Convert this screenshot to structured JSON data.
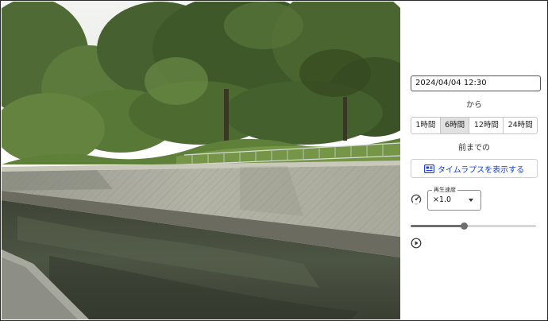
{
  "camera": {
    "scene": "river-channel-camera-image"
  },
  "controls": {
    "datetime_value": "2024/04/04 12:30",
    "from_label": "から",
    "ranges": [
      {
        "label": "1時間",
        "active": false
      },
      {
        "label": "6時間",
        "active": true
      },
      {
        "label": "12時間",
        "active": false
      },
      {
        "label": "24時間",
        "active": false
      }
    ],
    "before_label": "前までの",
    "timelapse_button": "タイムラプスを表示する",
    "speed": {
      "legend": "再生速度",
      "value": "×1.0"
    },
    "playback_progress": 0.43,
    "icons": {
      "timelapse": "slideshow-icon",
      "speed": "speedometer-icon",
      "play": "play-circle-icon"
    },
    "accent_color": "#1a3fd1"
  }
}
